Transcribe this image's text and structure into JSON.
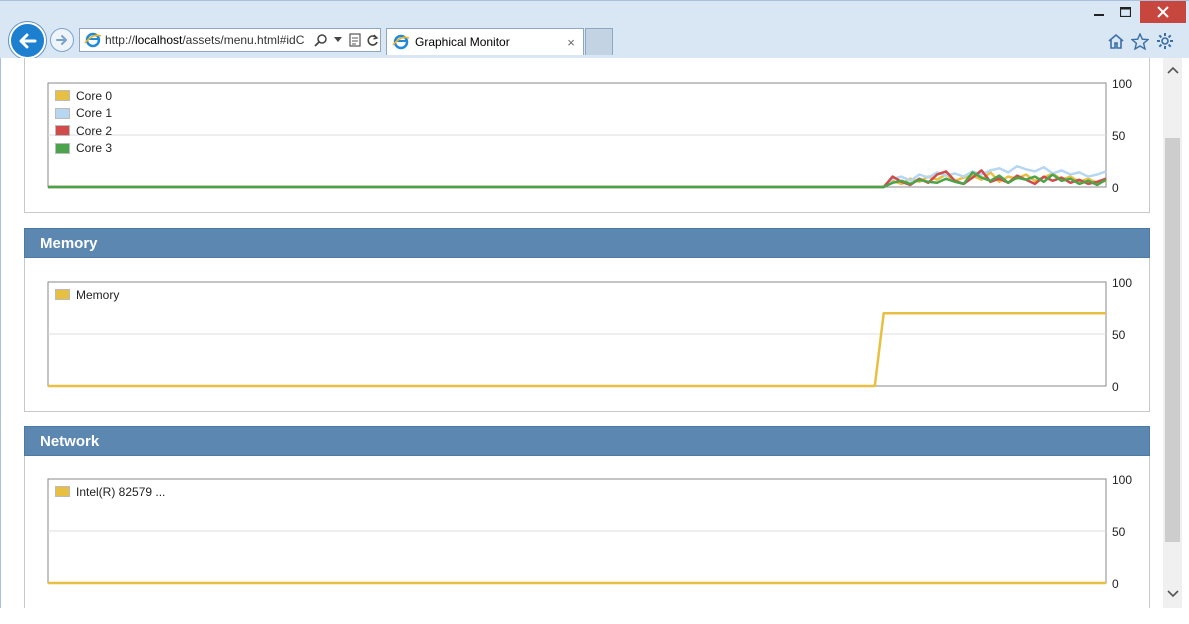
{
  "browser": {
    "url_prefix": "http://",
    "url_host": "localhost",
    "url_path": "/assets/menu.html#idC",
    "tab_title": "Graphical Monitor",
    "tab_close": "×"
  },
  "panels": {
    "cpu": {
      "legend": [
        {
          "name": "Core 0",
          "color": "#e8c041"
        },
        {
          "name": "Core 1",
          "color": "#b7d6f2"
        },
        {
          "name": "Core 2",
          "color": "#d24b4b"
        },
        {
          "name": "Core 3",
          "color": "#4ba34b"
        }
      ]
    },
    "memory": {
      "title": "Memory",
      "legend": [
        {
          "name": "Memory",
          "color": "#e8c041"
        }
      ]
    },
    "network": {
      "title": "Network",
      "legend": [
        {
          "name": "Intel(R) 82579 ...",
          "color": "#e8c041"
        }
      ]
    }
  },
  "chart_data": [
    {
      "type": "line",
      "ylim": [
        0,
        100
      ],
      "yticks": [
        "100",
        "50",
        "0"
      ],
      "grid": true,
      "legend_position": "top-left",
      "x": [
        0,
        1,
        2,
        3,
        4,
        5,
        6,
        7,
        8,
        9,
        10,
        11,
        12,
        13,
        14,
        15,
        16,
        17,
        18,
        19,
        20,
        21,
        22,
        23,
        24,
        25,
        26,
        27,
        28,
        29,
        30,
        31,
        32,
        33,
        34,
        35,
        36,
        37,
        38,
        39,
        40,
        41,
        42,
        43,
        44,
        45,
        46,
        47,
        48,
        49,
        50,
        51,
        52,
        53,
        54,
        55,
        56,
        57,
        58,
        59,
        60,
        61,
        62,
        63,
        64,
        65,
        66,
        67,
        68,
        69,
        70,
        71,
        72,
        73,
        74,
        75,
        76,
        77,
        78,
        79,
        80,
        81,
        82,
        83,
        84,
        85,
        86,
        87,
        88,
        89,
        90,
        91,
        92,
        93,
        94,
        95,
        96,
        97,
        98,
        99,
        100,
        101,
        102,
        103,
        104,
        105,
        106,
        107,
        108,
        109,
        110,
        111,
        112,
        113,
        114,
        115,
        116,
        117,
        118,
        119
      ],
      "series": [
        {
          "name": "Core 0",
          "color": "#e8c041",
          "values": [
            0,
            0,
            0,
            0,
            0,
            0,
            0,
            0,
            0,
            0,
            0,
            0,
            0,
            0,
            0,
            0,
            0,
            0,
            0,
            0,
            0,
            0,
            0,
            0,
            0,
            0,
            0,
            0,
            0,
            0,
            0,
            0,
            0,
            0,
            0,
            0,
            0,
            0,
            0,
            0,
            0,
            0,
            0,
            0,
            0,
            0,
            0,
            0,
            0,
            0,
            0,
            0,
            0,
            0,
            0,
            0,
            0,
            0,
            0,
            0,
            0,
            0,
            0,
            0,
            0,
            0,
            0,
            0,
            0,
            0,
            0,
            0,
            0,
            0,
            0,
            0,
            0,
            0,
            0,
            0,
            0,
            0,
            0,
            0,
            0,
            0,
            0,
            0,
            0,
            0,
            0,
            0,
            0,
            0,
            0,
            6,
            3,
            8,
            5,
            10,
            7,
            12,
            6,
            9,
            11,
            7,
            14,
            5,
            10,
            8,
            12,
            6,
            9,
            13,
            7,
            10,
            5,
            8,
            4,
            6
          ]
        },
        {
          "name": "Core 1",
          "color": "#b7d6f2",
          "values": [
            0,
            0,
            0,
            0,
            0,
            0,
            0,
            0,
            0,
            0,
            0,
            0,
            0,
            0,
            0,
            0,
            0,
            0,
            0,
            0,
            0,
            0,
            0,
            0,
            0,
            0,
            0,
            0,
            0,
            0,
            0,
            0,
            0,
            0,
            0,
            0,
            0,
            0,
            0,
            0,
            0,
            0,
            0,
            0,
            0,
            0,
            0,
            0,
            0,
            0,
            0,
            0,
            0,
            0,
            0,
            0,
            0,
            0,
            0,
            0,
            0,
            0,
            0,
            0,
            0,
            0,
            0,
            0,
            0,
            0,
            0,
            0,
            0,
            0,
            0,
            0,
            0,
            0,
            0,
            0,
            0,
            0,
            0,
            0,
            0,
            0,
            0,
            0,
            0,
            0,
            0,
            0,
            0,
            0,
            0,
            8,
            10,
            6,
            12,
            9,
            14,
            11,
            13,
            10,
            15,
            12,
            16,
            18,
            14,
            20,
            17,
            15,
            19,
            13,
            16,
            12,
            14,
            10,
            12,
            15
          ]
        },
        {
          "name": "Core 2",
          "color": "#d24b4b",
          "values": [
            0,
            0,
            0,
            0,
            0,
            0,
            0,
            0,
            0,
            0,
            0,
            0,
            0,
            0,
            0,
            0,
            0,
            0,
            0,
            0,
            0,
            0,
            0,
            0,
            0,
            0,
            0,
            0,
            0,
            0,
            0,
            0,
            0,
            0,
            0,
            0,
            0,
            0,
            0,
            0,
            0,
            0,
            0,
            0,
            0,
            0,
            0,
            0,
            0,
            0,
            0,
            0,
            0,
            0,
            0,
            0,
            0,
            0,
            0,
            0,
            0,
            0,
            0,
            0,
            0,
            0,
            0,
            0,
            0,
            0,
            0,
            0,
            0,
            0,
            0,
            0,
            0,
            0,
            0,
            0,
            0,
            0,
            0,
            0,
            0,
            0,
            0,
            0,
            0,
            0,
            0,
            0,
            0,
            0,
            0,
            10,
            5,
            2,
            8,
            4,
            12,
            15,
            6,
            3,
            9,
            16,
            5,
            8,
            4,
            11,
            7,
            3,
            10,
            6,
            9,
            4,
            7,
            3,
            5,
            8
          ]
        },
        {
          "name": "Core 3",
          "color": "#4ba34b",
          "values": [
            0,
            0,
            0,
            0,
            0,
            0,
            0,
            0,
            0,
            0,
            0,
            0,
            0,
            0,
            0,
            0,
            0,
            0,
            0,
            0,
            0,
            0,
            0,
            0,
            0,
            0,
            0,
            0,
            0,
            0,
            0,
            0,
            0,
            0,
            0,
            0,
            0,
            0,
            0,
            0,
            0,
            0,
            0,
            0,
            0,
            0,
            0,
            0,
            0,
            0,
            0,
            0,
            0,
            0,
            0,
            0,
            0,
            0,
            0,
            0,
            0,
            0,
            0,
            0,
            0,
            0,
            0,
            0,
            0,
            0,
            0,
            0,
            0,
            0,
            0,
            0,
            0,
            0,
            0,
            0,
            0,
            0,
            0,
            0,
            0,
            0,
            0,
            0,
            0,
            0,
            0,
            0,
            0,
            0,
            0,
            4,
            6,
            3,
            7,
            5,
            4,
            8,
            5,
            3,
            14,
            9,
            6,
            11,
            4,
            9,
            7,
            10,
            5,
            12,
            6,
            8,
            3,
            6,
            2,
            7
          ]
        }
      ]
    },
    {
      "type": "line",
      "ylim": [
        0,
        100
      ],
      "yticks": [
        "100",
        "50",
        "0"
      ],
      "grid": true,
      "legend_position": "top-left",
      "x": [
        0,
        93,
        94,
        119
      ],
      "series": [
        {
          "name": "Memory",
          "color": "#e8c041",
          "values": [
            0,
            0,
            70,
            70
          ]
        }
      ]
    },
    {
      "type": "line",
      "ylim": [
        0,
        100
      ],
      "yticks": [
        "100",
        "50",
        "0"
      ],
      "grid": true,
      "legend_position": "top-left",
      "x": [
        0,
        119
      ],
      "series": [
        {
          "name": "Intel(R) 82579 ...",
          "color": "#e8c041",
          "values": [
            0,
            0
          ]
        }
      ]
    }
  ]
}
